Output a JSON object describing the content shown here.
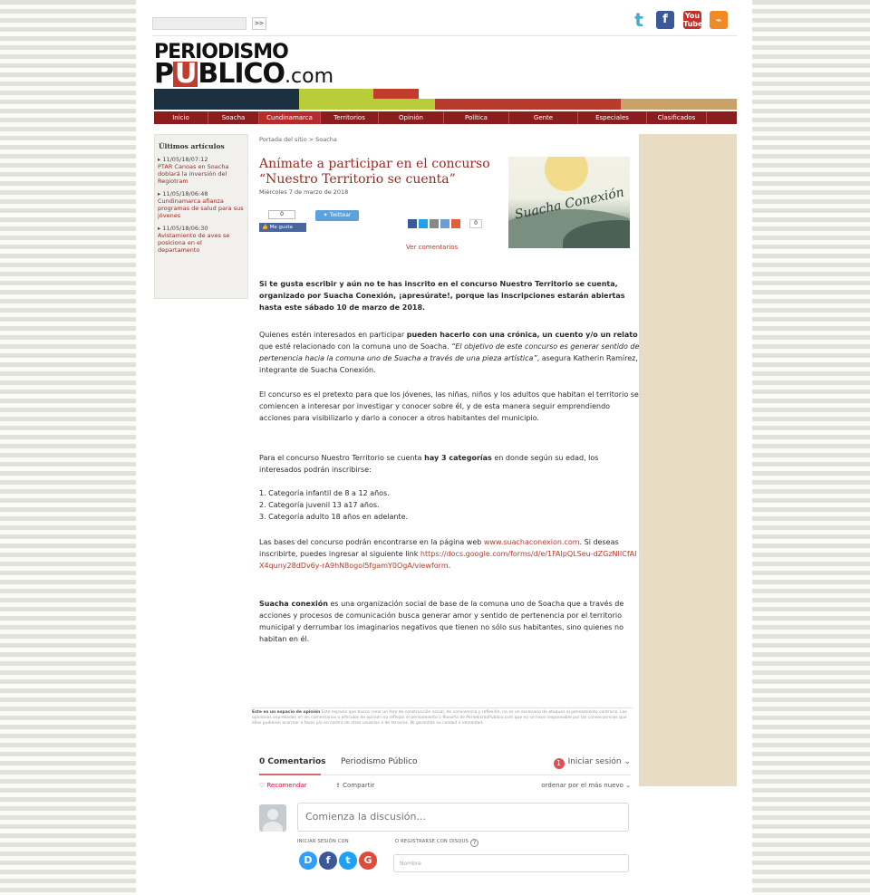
{
  "header": {
    "search_go": ">>",
    "social": {
      "twitter": "t",
      "facebook": "f",
      "youtube": "You Tube",
      "rss": "⌁"
    },
    "logo": {
      "top": "PERIODISMO",
      "u_letter": "U",
      "bottom_pre": "P",
      "bottom_post": "BLICO",
      "suffix": ".com"
    }
  },
  "nav": {
    "items": [
      "Inicio",
      "Soacha",
      "Cundinamarca",
      "Territorios",
      "Opinión",
      "Política",
      "Gente",
      "Especiales",
      "Clasificados"
    ],
    "active_index": 2
  },
  "sidebar": {
    "title": "Últimos artículos",
    "items": [
      {
        "date": "11/05/18/07:12",
        "text": "PTAR Canoas en Soacha doblará la inversión del Regiotram"
      },
      {
        "date": "11/05/18/06:48",
        "text": "Cundinamarca afianza programas de salud para sus jóvenes"
      },
      {
        "date": "11/05/18/06:30",
        "text": "Avistamiento de aves se posiciona en el departamento"
      }
    ]
  },
  "article": {
    "breadcrumb": "Portada del sitio > Soacha",
    "title": "Anímate a participar en el concurso “Nuestro Territorio se cuenta”",
    "date": "Miércoles 7 de marzo de 2018",
    "like_count": "0",
    "like_label": "Me gusta",
    "tweet_label": "Twittear",
    "share_count": "0",
    "comments_link": "Ver comentarios",
    "hero_text": "Suacha Conexión",
    "p1": "Si te gusta escribir y aún no te has inscrito en el concurso Nuestro Territorio se cuenta, organizado por Suacha Conexión, ¡apresúrate!, porque las inscripciones estarán abiertas hasta este sábado 10 de marzo de 2018.",
    "p2_a": "Quienes estén interesados en participar ",
    "p2_b": "pueden hacerlo con una crónica, un cuento y/o un relato",
    "p2_c": " que esté relacionado con la comuna uno de Soacha. ",
    "p2_d": "“El objetivo de este concurso es generar sentido de pertenencia hacia la comuna uno de Suacha a través de una pieza artística”",
    "p2_e": ", asegura Katherin Ramírez, integrante de Suacha Conexión.",
    "p3": "El concurso es el pretexto para que los jóvenes, las niñas, niños y los adultos que habitan el territorio se comiencen a interesar por investigar y conocer sobre él, y de esta manera seguir emprendiendo acciones para visibilizarlo y darlo a conocer a otros habitantes del municipio.",
    "p4_a": "Para el concurso Nuestro Territorio se cuenta ",
    "p4_b": "hay 3 categorías",
    "p4_c": " en donde según su edad, los interesados podrán inscribirse:",
    "list": [
      "1. Categoría infantil de 8 a 12 años.",
      "2. Categoría juvenil 13 a17 años.",
      "3. Categoría adulto 18 años en adelante."
    ],
    "p5_a": "Las bases del concurso podrán encontrarse en la página web ",
    "p5_link1": "www.suachaconexion.com",
    "p5_b": ". Si deseas inscribirte, puedes ingresar al siguiente link ",
    "p5_link2": "https://docs.google.com/forms/d/e/1FAIpQLSeu-dZGzNIICfAIX4quny28dDv6y-rA9hN8ogol5fgamY0OgA/viewform",
    "p5_c": ".",
    "p6_a": "Suacha conexión",
    "p6_b": " es una organización social de base de la comuna uno de Soacha que a través de acciones y procesos de comunicación busca generar amor y sentido de pertenencia por el territorio municipal y derrumbar los imaginarios negativos que tienen no sólo sus habitantes, sino quienes no habitan en él.",
    "opinion_title": "Este es un espacio de opinión",
    "opinion_text": "Este espacio que busca crear un foro de construcción social, de convivencia y reflexión, no es un escenario de ataques al pensamiento contrario. Las opiniones expresadas en los comentarios o artículos de opinión no reflejan el pensamiento o filosofía de PeriodismoPublico.com que no se hace responsable por las consecuencias que ellas pudieren acarrear a favor y/o en contra de otros usuarios o de terceros. Ni garantías su calidad o idoneidad."
  },
  "disqus": {
    "tab_comments": "0 Comentarios",
    "tab_site": "Periodismo Público",
    "login_badge": "1",
    "login": "Iniciar sesión",
    "recommend": "♡ Recomendar",
    "share": "⇪ Compartir",
    "sort": "ordenar por el más nuevo ⌄",
    "placeholder": "Comienza la discusión...",
    "login_with": "INICIAR SESIÓN CON",
    "register": "O REGISTRARSE CON DISQUS",
    "help": "?",
    "login_icons": [
      "D",
      "f",
      "t",
      "G"
    ],
    "name_placeholder": "Nombre"
  }
}
